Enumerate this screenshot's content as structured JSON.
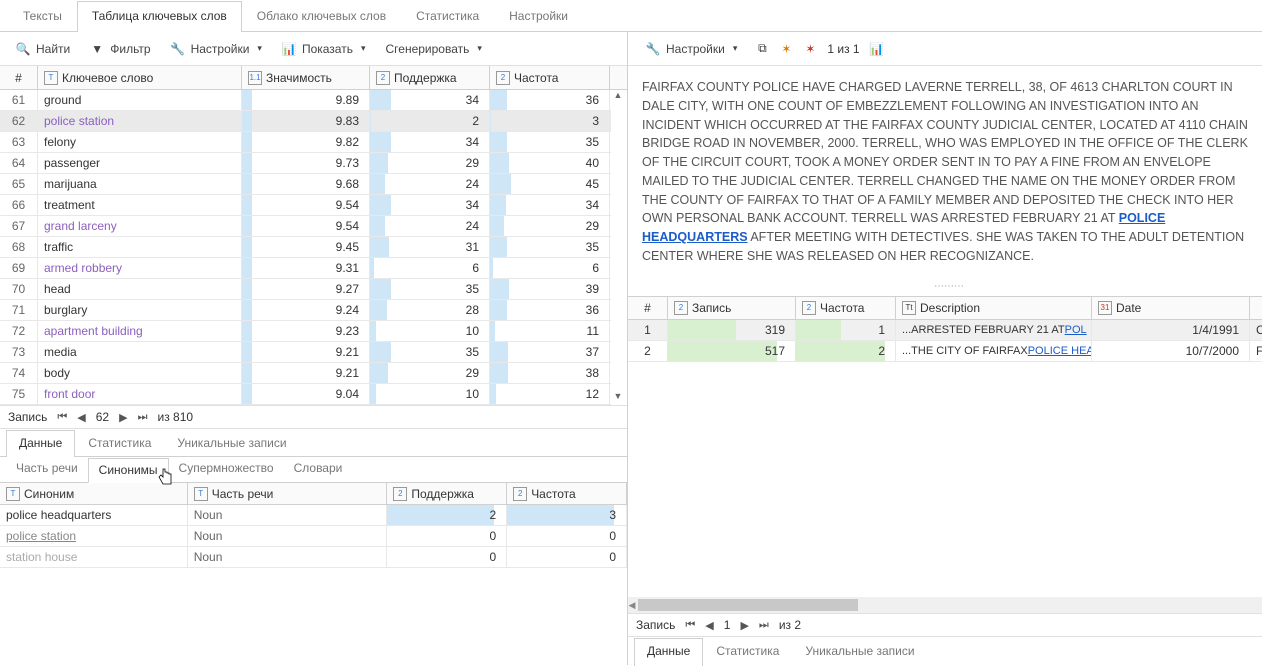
{
  "top_tabs": [
    "Тексты",
    "Таблица ключевых слов",
    "Облако ключевых слов",
    "Статистика",
    "Настройки"
  ],
  "top_tab_active": 1,
  "toolbar": {
    "find": "Найти",
    "filter": "Фильтр",
    "settings": "Настройки",
    "show": "Показать",
    "generate": "Сгенерировать"
  },
  "grid_headers": {
    "num": "#",
    "keyword": "Ключевое слово",
    "significance": "Значимость",
    "support": "Поддержка",
    "frequency": "Частота"
  },
  "rows": [
    {
      "n": 61,
      "key": "ground",
      "sig": "9.89",
      "sup": 34,
      "freq": 36,
      "link": false
    },
    {
      "n": 62,
      "key": "police station",
      "sig": "9.83",
      "sup": 2,
      "freq": 3,
      "link": true,
      "sel": true
    },
    {
      "n": 63,
      "key": "felony",
      "sig": "9.82",
      "sup": 34,
      "freq": 35,
      "link": false
    },
    {
      "n": 64,
      "key": "passenger",
      "sig": "9.73",
      "sup": 29,
      "freq": 40,
      "link": false
    },
    {
      "n": 65,
      "key": "marijuana",
      "sig": "9.68",
      "sup": 24,
      "freq": 45,
      "link": false
    },
    {
      "n": 66,
      "key": "treatment",
      "sig": "9.54",
      "sup": 34,
      "freq": 34,
      "link": false
    },
    {
      "n": 67,
      "key": "grand larceny",
      "sig": "9.54",
      "sup": 24,
      "freq": 29,
      "link": true
    },
    {
      "n": 68,
      "key": "traffic",
      "sig": "9.45",
      "sup": 31,
      "freq": 35,
      "link": false
    },
    {
      "n": 69,
      "key": "armed robbery",
      "sig": "9.31",
      "sup": 6,
      "freq": 6,
      "link": true
    },
    {
      "n": 70,
      "key": "head",
      "sig": "9.27",
      "sup": 35,
      "freq": 39,
      "link": false
    },
    {
      "n": 71,
      "key": "burglary",
      "sig": "9.24",
      "sup": 28,
      "freq": 36,
      "link": false
    },
    {
      "n": 72,
      "key": "apartment building",
      "sig": "9.23",
      "sup": 10,
      "freq": 11,
      "link": true
    },
    {
      "n": 73,
      "key": "media",
      "sig": "9.21",
      "sup": 35,
      "freq": 37,
      "link": false
    },
    {
      "n": 74,
      "key": "body",
      "sig": "9.21",
      "sup": 29,
      "freq": 38,
      "link": false
    },
    {
      "n": 75,
      "key": "front door",
      "sig": "9.04",
      "sup": 10,
      "freq": 12,
      "link": true
    }
  ],
  "pager": {
    "label": "Запись",
    "current": "62",
    "total": "из 810"
  },
  "sub_tabs": [
    "Данные",
    "Статистика",
    "Уникальные записи"
  ],
  "sub_tab_active": 0,
  "inner_tabs": [
    "Часть речи",
    "Синонимы",
    "Супермножество",
    "Словари"
  ],
  "inner_tab_active": 1,
  "syn_headers": {
    "syn": "Синоним",
    "pos": "Часть речи",
    "sup": "Поддержка",
    "freq": "Частота"
  },
  "syn_rows": [
    {
      "syn": "police headquarters",
      "pos": "Noun",
      "sup": 2,
      "freq": 3,
      "u": false
    },
    {
      "syn": "police station",
      "pos": "Noun",
      "sup": 0,
      "freq": 0,
      "u": true
    },
    {
      "syn": "station house",
      "pos": "Noun",
      "sup": 0,
      "freq": 0,
      "u": false,
      "gray": true
    }
  ],
  "right_toolbar": {
    "settings": "Настройки",
    "counter": "1 из 1"
  },
  "article": {
    "pre": "FAIRFAX COUNTY POLICE HAVE CHARGED LAVERNE TERRELL, 38, OF 4613 CHARLTON COURT IN DALE CITY, WITH ONE COUNT OF EMBEZZLEMENT FOLLOWING AN INVESTIGATION INTO AN INCIDENT WHICH OCCURRED AT THE FAIRFAX COUNTY JUDICIAL CENTER, LOCATED AT 4110 CHAIN BRIDGE ROAD IN NOVEMBER, 2000. TERRELL, WHO WAS EMPLOYED IN THE OFFICE OF THE CLERK OF THE CIRCUIT COURT, TOOK A MONEY ORDER SENT IN TO PAY A FINE FROM AN ENVELOPE MAILED TO THE JUDICIAL CENTER. TERRELL CHANGED THE NAME ON THE MONEY ORDER FROM THE COUNTY OF FAIRFAX TO THAT OF A FAMILY MEMBER AND DEPOSITED THE CHECK INTO HER OWN PERSONAL BANK ACCOUNT. TERRELL WAS ARRESTED FEBRUARY 21 AT ",
    "link": "POLICE HEADQUARTERS",
    "post": " AFTER MEETING WITH DETECTIVES. SHE WAS TAKEN TO THE ADULT DETENTION CENTER WHERE SHE WAS RELEASED ON HER RECOGNIZANCE."
  },
  "detail_headers": {
    "n": "#",
    "rec": "Запись",
    "freq": "Частота",
    "desc": "Description",
    "date": "Date"
  },
  "detail_rows": [
    {
      "n": 1,
      "rec": 319,
      "freq": 1,
      "desc_pre": "...ARRESTED FEBRUARY 21 AT ",
      "desc_link": "POL",
      "date": "1/4/1991",
      "ex": "CF",
      "sel": true
    },
    {
      "n": 2,
      "rec": 517,
      "freq": 2,
      "desc_pre": "...THE CITY OF FAIRFAX ",
      "desc_link": "POLICE HEA",
      "date": "10/7/2000",
      "ex": "FA",
      "sel": false
    }
  ],
  "right_pager": {
    "label": "Запись",
    "current": "1",
    "total": "из 2"
  },
  "right_sub_tabs": [
    "Данные",
    "Статистика",
    "Уникальные записи"
  ],
  "right_sub_active": 0
}
